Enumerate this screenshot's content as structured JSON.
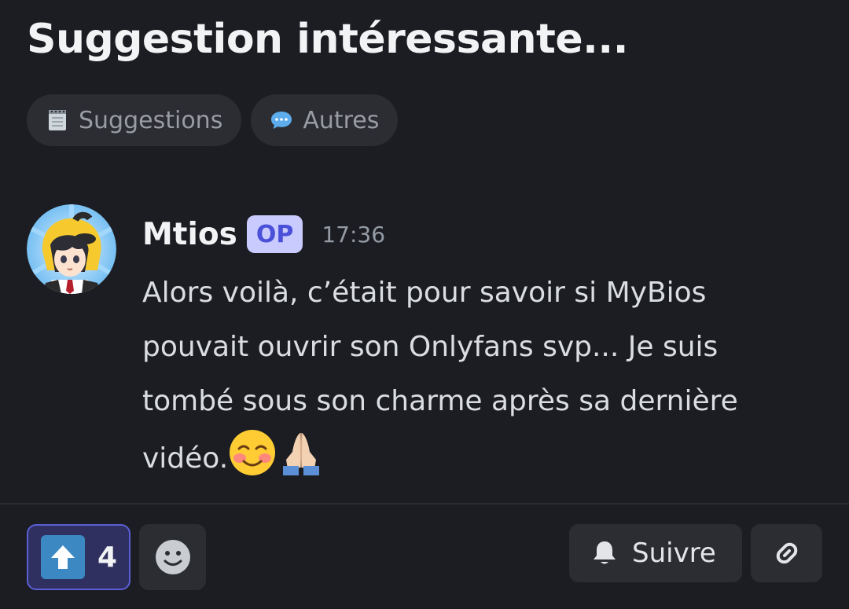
{
  "thread": {
    "title": "Suggestion intéressante..."
  },
  "tags": [
    {
      "label": "Suggestions",
      "icon": "notepad-icon"
    },
    {
      "label": "Autres",
      "icon": "speech-bubble-icon"
    }
  ],
  "message": {
    "author": "Mtios",
    "op_badge": "OP",
    "timestamp": "17:36",
    "lines": [
      "Alors voilà, c’était pour savoir si MyBios",
      "pouvait ouvrir son Onlyfans svp... Je suis",
      "tombé sous son charme après sa dernière",
      "vidéo."
    ],
    "emojis": [
      "smiling-blush-emoji",
      "folded-hands-emoji"
    ]
  },
  "footer": {
    "upvote_count": "4",
    "follow_label": "Suivre"
  },
  "colors": {
    "background": "#1c1d22",
    "pill": "#2b2d33",
    "op_badge_bg": "#c9cbff",
    "op_badge_text": "#4b50d8",
    "upvote_bg": "#2f3060",
    "upvote_border": "#5a5fd6"
  }
}
